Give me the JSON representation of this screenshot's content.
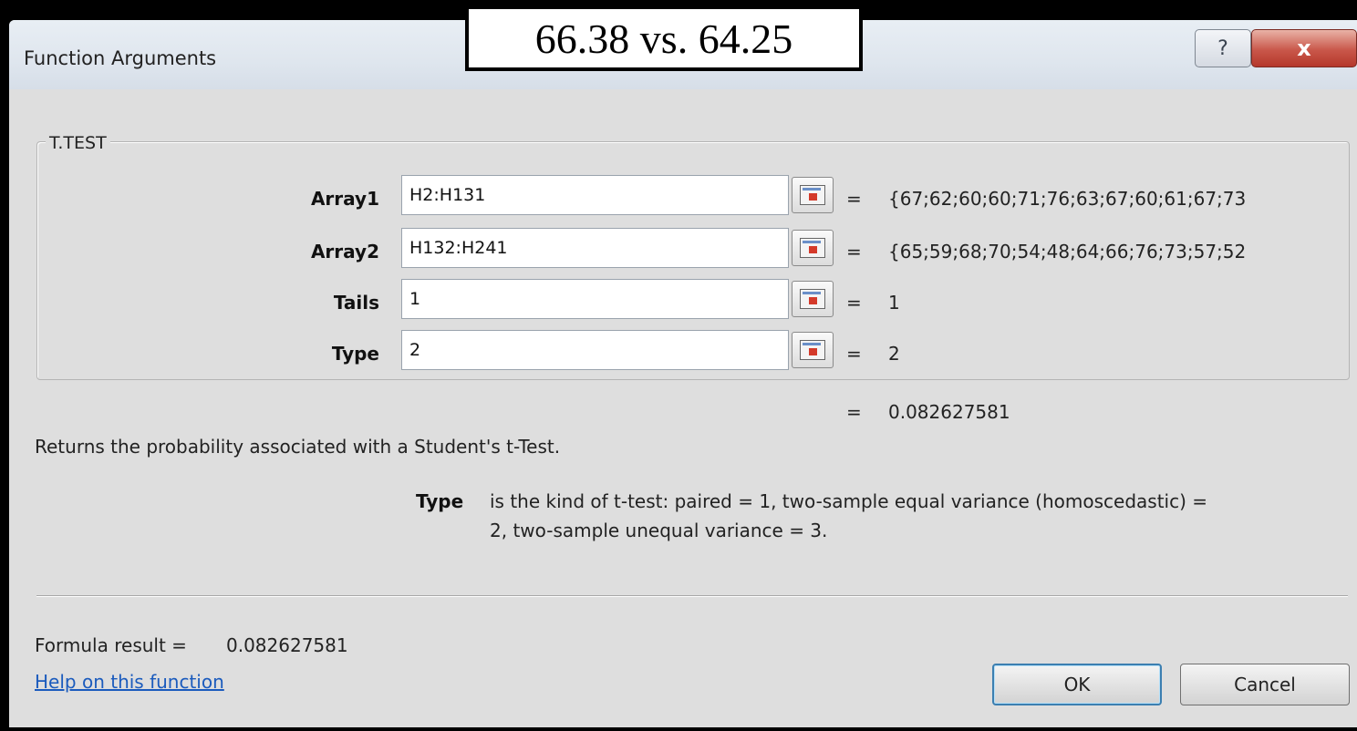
{
  "overlay": {
    "text": "66.38 vs. 64.25"
  },
  "window": {
    "title": "Function Arguments",
    "help": "?",
    "close": "x"
  },
  "function_name": "T.TEST",
  "arguments": [
    {
      "name": "Array1",
      "value": "H2:H131",
      "result": "{67;62;60;60;71;76;63;67;60;61;67;73"
    },
    {
      "name": "Array2",
      "value": "H132:H241",
      "result": "{65;59;68;70;54;48;64;66;76;73;57;52"
    },
    {
      "name": "Tails",
      "value": "1",
      "result": "1"
    },
    {
      "name": "Type",
      "value": "2",
      "result": "2"
    }
  ],
  "equals_sign": "=",
  "overall_result": "0.082627581",
  "description": "Returns the probability associated with a Student's t-Test.",
  "arg_help": {
    "name": "Type",
    "line1": "is the kind of t-test: paired = 1, two-sample equal variance (homoscedastic) =",
    "line2": "2, two-sample unequal variance = 3."
  },
  "formula_result": {
    "label": "Formula result =",
    "value": "0.082627581"
  },
  "help_link": "Help on this function",
  "buttons": {
    "ok": "OK",
    "cancel": "Cancel"
  }
}
